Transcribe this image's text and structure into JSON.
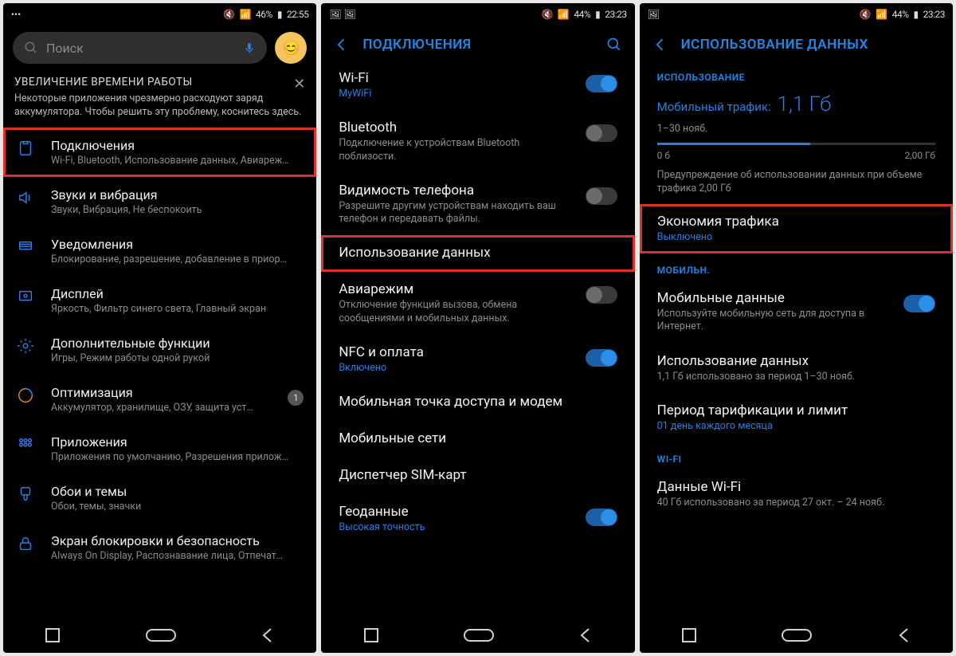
{
  "phone1": {
    "status": {
      "left_icons": "•••",
      "mute": "🔇",
      "signal": "📶",
      "battery": "46%",
      "time": "22:55"
    },
    "search": {
      "placeholder": "Поиск",
      "mic": "🎤",
      "avatar": "😊"
    },
    "tip": {
      "title": "УВЕЛИЧЕНИЕ ВРЕМЕНИ РАБОТЫ",
      "body": "Некоторые приложения чрезмерно расходуют заряд аккумулятора. Чтобы решить эту проблему, коснитесь здесь."
    },
    "items": [
      {
        "title": "Подключения",
        "sub": "Wi-Fi, Bluetooth, Использование данных, Авиареж…",
        "highlight": true
      },
      {
        "title": "Звуки и вибрация",
        "sub": "Звуки, Вибрация, Не беспокоить"
      },
      {
        "title": "Уведомления",
        "sub": "Блокирование, разрешение, добавление в приор…"
      },
      {
        "title": "Дисплей",
        "sub": "Яркость, Фильтр синего света, Главный экран"
      },
      {
        "title": "Дополнительные функции",
        "sub": "Игры, Режим работы одной рукой"
      },
      {
        "title": "Оптимизация",
        "sub": "Аккумулятор, хранилище, ОЗУ, защита уст…",
        "badge": "1"
      },
      {
        "title": "Приложения",
        "sub": "Приложения по умолчанию, Разрешения прилож…"
      },
      {
        "title": "Обои и темы",
        "sub": "Обои, темы, значки"
      },
      {
        "title": "Экран блокировки и безопасность",
        "sub": "Always On Display, Распознавание лица, Отпечат…"
      }
    ]
  },
  "phone2": {
    "status": {
      "left_icons": "🖼 🖼",
      "mute": "🔇",
      "signal": "📶",
      "battery": "44%",
      "time": "23:23"
    },
    "header": "ПОДКЛЮЧЕНИЯ",
    "items": [
      {
        "title": "Wi-Fi",
        "sub": "MyWiFi",
        "sub_blue": true,
        "toggle": "on"
      },
      {
        "title": "Bluetooth",
        "sub": "Подключение к устройствам Bluetooth поблизости.",
        "toggle": "off"
      },
      {
        "title": "Видимость телефона",
        "sub": "Разрешите другим устройствам находить ваш телефон и передавать файлы.",
        "toggle": "off"
      },
      {
        "title": "Использование данных",
        "highlight": true
      },
      {
        "title": "Авиарежим",
        "sub": "Отключение функций вызова, обмена сообщениями и мобильных данных.",
        "toggle": "off"
      },
      {
        "title": "NFC и оплата",
        "sub": "Включено",
        "sub_blue": true,
        "toggle": "on"
      },
      {
        "title": "Мобильная точка доступа и модем"
      },
      {
        "title": "Мобильные сети"
      },
      {
        "title": "Диспетчер SIM-карт"
      },
      {
        "title": "Геоданные",
        "sub": "Высокая точность",
        "sub_blue": true,
        "toggle": "on"
      }
    ]
  },
  "phone3": {
    "status": {
      "left_icons": "🖼",
      "mute": "🔇",
      "signal": "📶",
      "battery": "44%",
      "time": "23:23"
    },
    "header": "ИСПОЛЬЗОВАНИЕ ДАННЫХ",
    "section_usage": "ИСПОЛЬЗОВАНИЕ",
    "usage": {
      "label": "Мобильный трафик:",
      "value": "1,1 Гб",
      "period": "1–30 нояб.",
      "scale_min": "0 б",
      "scale_max": "2,00 Гб",
      "warning": "Предупреждение об использовании данных при объеме трафика 2,00 Гб"
    },
    "saver": {
      "title": "Экономия трафика",
      "sub": "Выключено",
      "highlight": true
    },
    "section_mobile": "МОБИЛЬН.",
    "mobile": [
      {
        "title": "Мобильные данные",
        "sub": "Используйте мобильную сеть для доступа в Интернет.",
        "toggle": "on"
      },
      {
        "title": "Использование данных",
        "sub": "1,1 Гб использовано за период 1–30 нояб."
      },
      {
        "title": "Период тарификации и лимит",
        "sub": "01 день каждого месяца",
        "sub_blue": true
      }
    ],
    "section_wifi": "WI-FI",
    "wifi": [
      {
        "title": "Данные Wi-Fi",
        "sub": "40 Гб использовано за период 27 окт. – 24 нояб."
      }
    ]
  }
}
